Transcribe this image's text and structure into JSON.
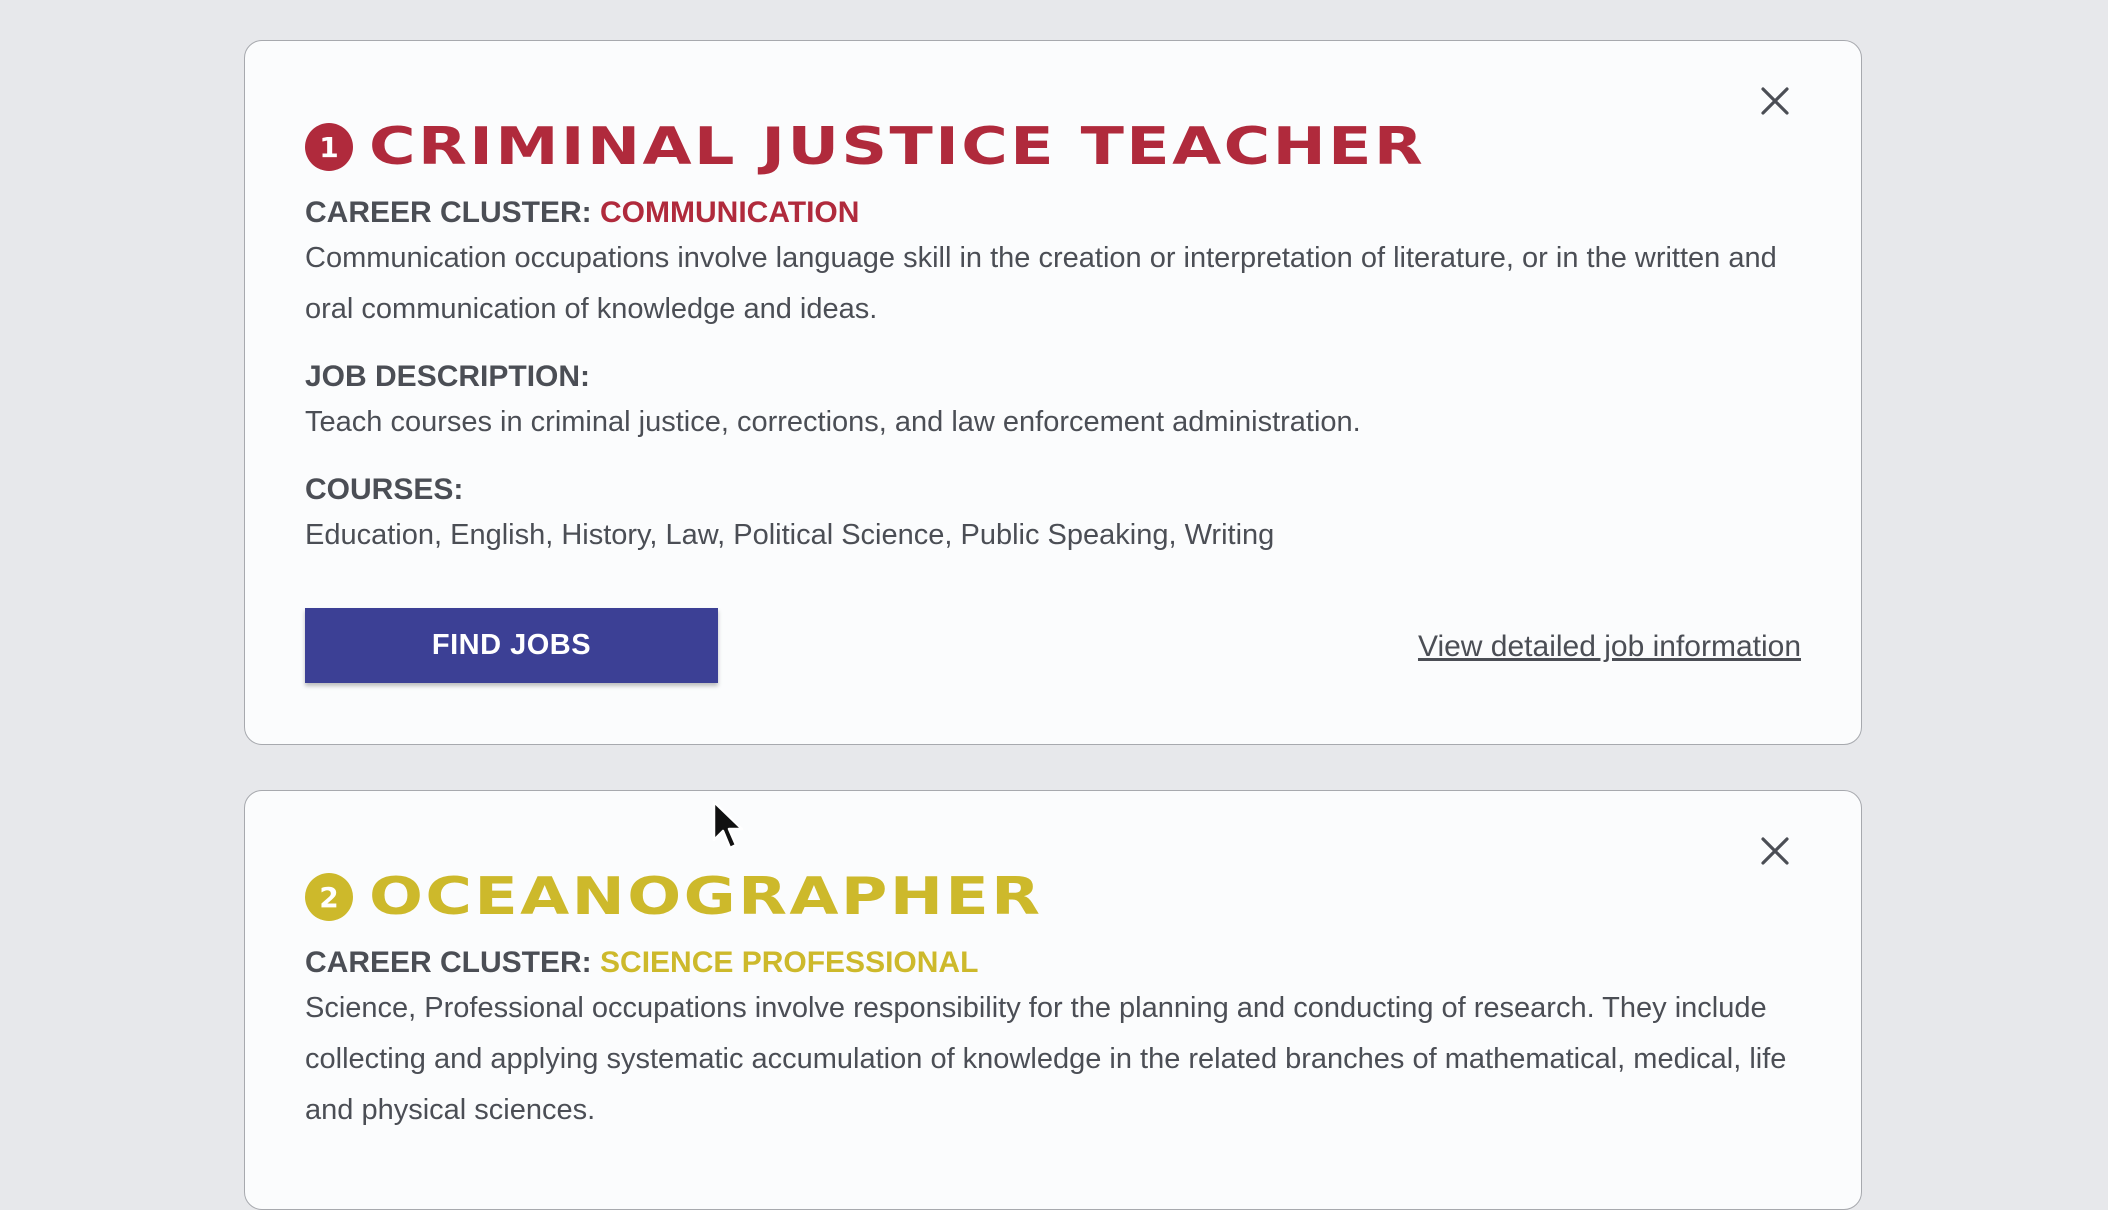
{
  "colors": {
    "page_background": "#e7e8eb",
    "card_background": "#fbfcfd",
    "text_gray": "#4b4e55",
    "button_blue": "#3c4095",
    "communication_red": "#b02a3c",
    "science_yellow": "#cdb92b"
  },
  "cards": [
    {
      "number": "1",
      "title": "CRIMINAL JUSTICE TEACHER",
      "cluster_label": "CAREER CLUSTER:",
      "cluster_name": "COMMUNICATION",
      "cluster_description": "Communication occupations involve language skill in the creation or interpretation of literature, or in the written and oral communication of knowledge and ideas.",
      "job_description_label": "JOB DESCRIPTION:",
      "job_description": "Teach courses in criminal justice, corrections, and law enforcement administration.",
      "courses_label": "COURSES:",
      "courses": "Education, English, History, Law, Political Science, Public Speaking, Writing",
      "find_jobs_label": "FIND JOBS",
      "detail_link_label": "View detailed job information",
      "close_icon": "close-icon"
    },
    {
      "number": "2",
      "title": "OCEANOGRAPHER",
      "cluster_label": "CAREER CLUSTER:",
      "cluster_name": "SCIENCE PROFESSIONAL",
      "cluster_description": "Science, Professional occupations involve responsibility for the planning and conducting of research. They include collecting and applying systematic accumulation of knowledge in the related branches of mathematical, medical, life and physical sciences.",
      "close_icon": "close-icon"
    }
  ],
  "cursor_icon": "mouse-pointer-icon"
}
